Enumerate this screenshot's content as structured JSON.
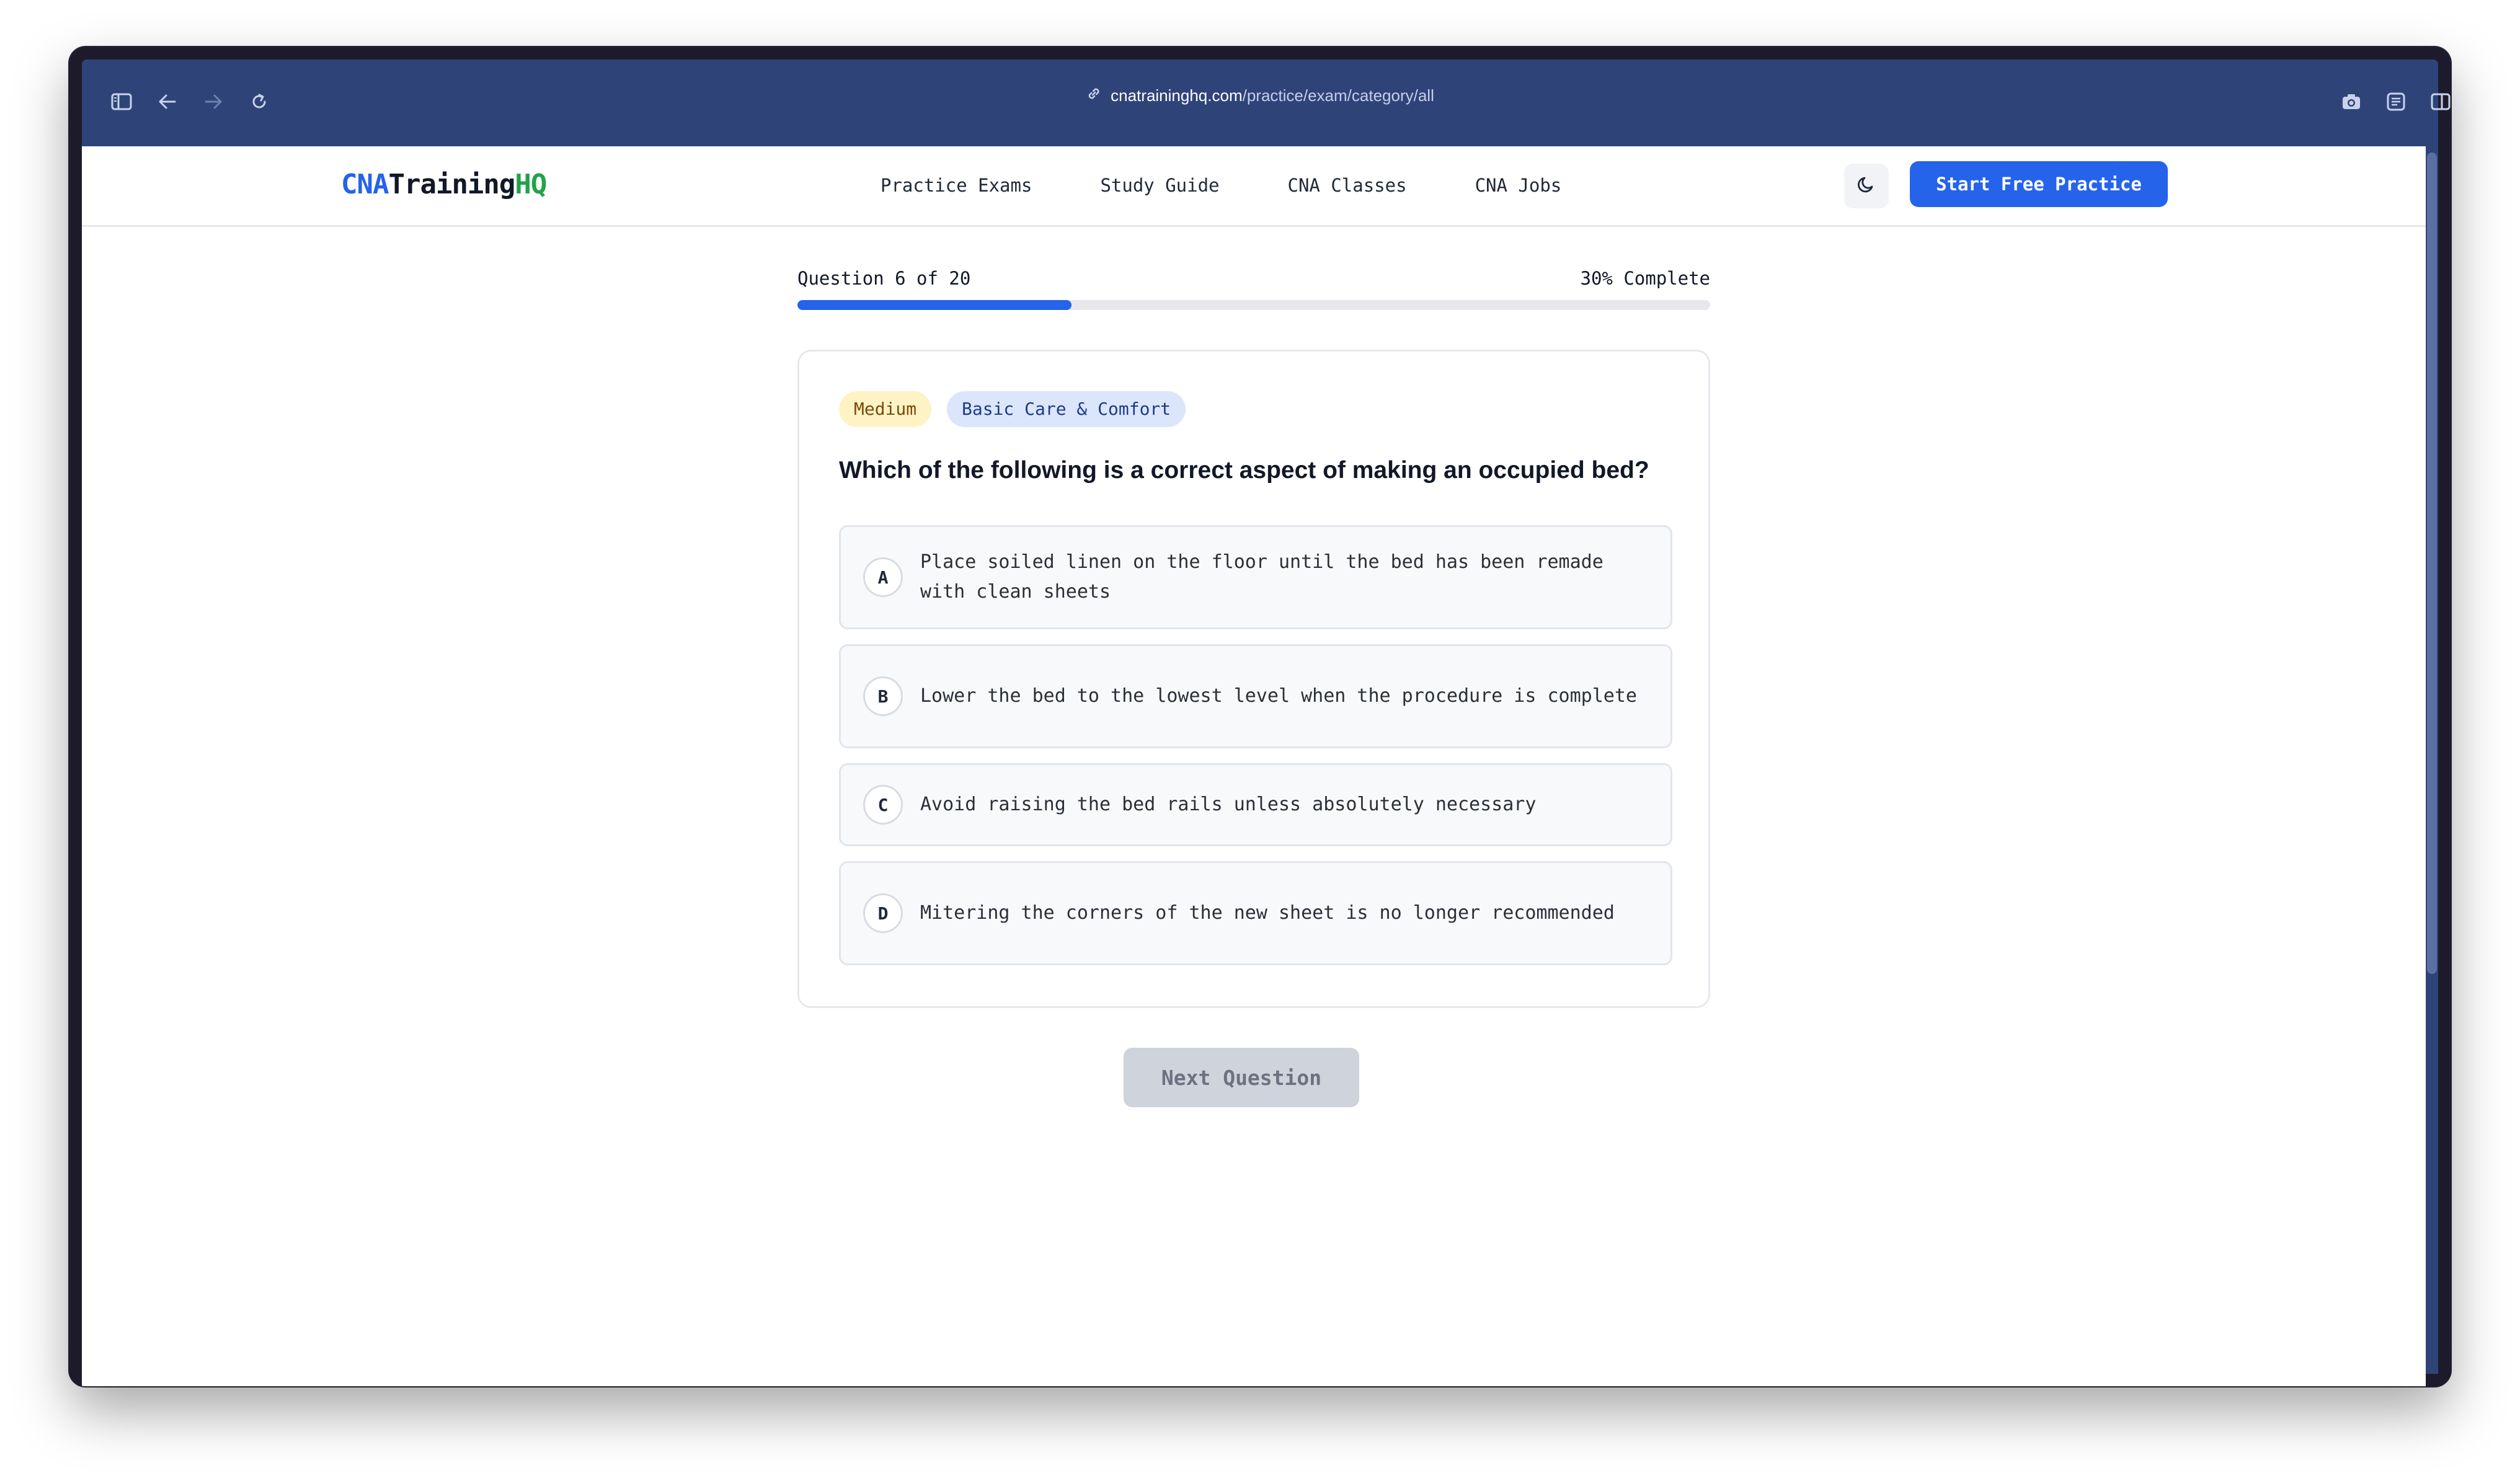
{
  "browser": {
    "url_domain": "cnatraininghq.com",
    "url_path": "/practice/exam/category/all"
  },
  "logo": {
    "part1": "CNA",
    "part2": "Training",
    "part3": "HQ"
  },
  "nav": {
    "links": [
      "Practice Exams",
      "Study Guide",
      "CNA Classes",
      "CNA Jobs"
    ],
    "cta_label": "Start Free Practice"
  },
  "progress": {
    "question_label": "Question 6 of 20",
    "complete_label": "30% Complete",
    "fraction": 0.3
  },
  "quiz": {
    "difficulty": "Medium",
    "category": "Basic Care & Comfort",
    "question": "Which of the following is a correct aspect of making an occupied bed?",
    "options": [
      {
        "letter": "A",
        "text": "Place soiled linen on the floor until the bed has been remade with clean sheets"
      },
      {
        "letter": "B",
        "text": "Lower the bed to the lowest level when the procedure is complete"
      },
      {
        "letter": "C",
        "text": "Avoid raising the bed rails unless absolutely necessary"
      },
      {
        "letter": "D",
        "text": "Mitering the corners of the new sheet is no longer recommended"
      }
    ],
    "next_label": "Next Question"
  },
  "colors": {
    "accent": "#2563eb",
    "logo_green": "#22a34a",
    "titlebar": "#2e4479"
  },
  "icons": {
    "sidebar": "sidebar-toggle-icon",
    "back": "arrow-left-icon",
    "forward": "arrow-right-icon",
    "reload": "reload-icon",
    "link": "link-icon",
    "camera": "camera-icon",
    "reader": "reader-icon",
    "split": "split-view-icon",
    "theme": "moon-icon"
  }
}
